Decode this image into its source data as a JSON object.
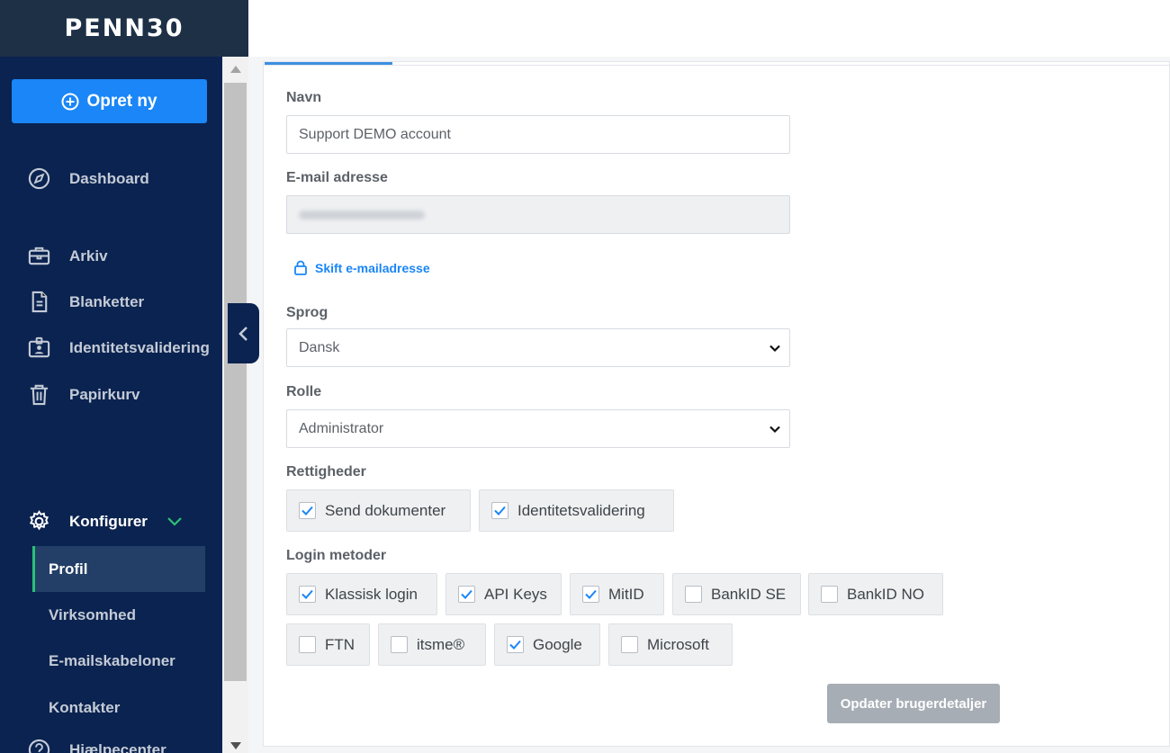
{
  "app": {
    "logo_text": "PENN30",
    "brand_color": "#0b2350",
    "accent_color": "#1a86f7"
  },
  "sidebar": {
    "create_label": "Opret ny",
    "items": [
      {
        "label": "Dashboard",
        "icon": "compass-icon"
      },
      {
        "label": "Arkiv",
        "icon": "briefcase-icon"
      },
      {
        "label": "Blanketter",
        "icon": "document-icon"
      },
      {
        "label": "Identitetsvalidering",
        "icon": "id-badge-icon"
      },
      {
        "label": "Papirkurv",
        "icon": "trash-icon"
      }
    ],
    "configure": {
      "label": "Konfigurer",
      "icon": "gear-icon"
    },
    "sub_items": [
      {
        "label": "Profil",
        "active": true
      },
      {
        "label": "Virksomhed"
      },
      {
        "label": "E-mailskabeloner"
      },
      {
        "label": "Kontakter"
      }
    ],
    "help_label": "Hjælpecenter"
  },
  "form": {
    "name_label": "Navn",
    "name_value": "Support DEMO account",
    "email_label": "E-mail adresse",
    "change_email_label": "Skift e-mailadresse",
    "language_label": "Sprog",
    "language_value": "Dansk",
    "role_label": "Rolle",
    "role_value": "Administrator",
    "rights_label": "Rettigheder",
    "rights": [
      {
        "label": "Send dokumenter",
        "checked": true
      },
      {
        "label": "Identitetsvalidering",
        "checked": true
      }
    ],
    "login_label": "Login metoder",
    "login_methods": [
      {
        "label": "Klassisk login",
        "checked": true
      },
      {
        "label": "API Keys",
        "checked": true
      },
      {
        "label": "MitID",
        "checked": true
      },
      {
        "label": "BankID SE",
        "checked": false
      },
      {
        "label": "BankID NO",
        "checked": false
      },
      {
        "label": "FTN",
        "checked": false
      },
      {
        "label": "itsme®",
        "checked": false
      },
      {
        "label": "Google",
        "checked": true
      },
      {
        "label": "Microsoft",
        "checked": false
      }
    ],
    "update_label": "Opdater brugerdetaljer"
  }
}
